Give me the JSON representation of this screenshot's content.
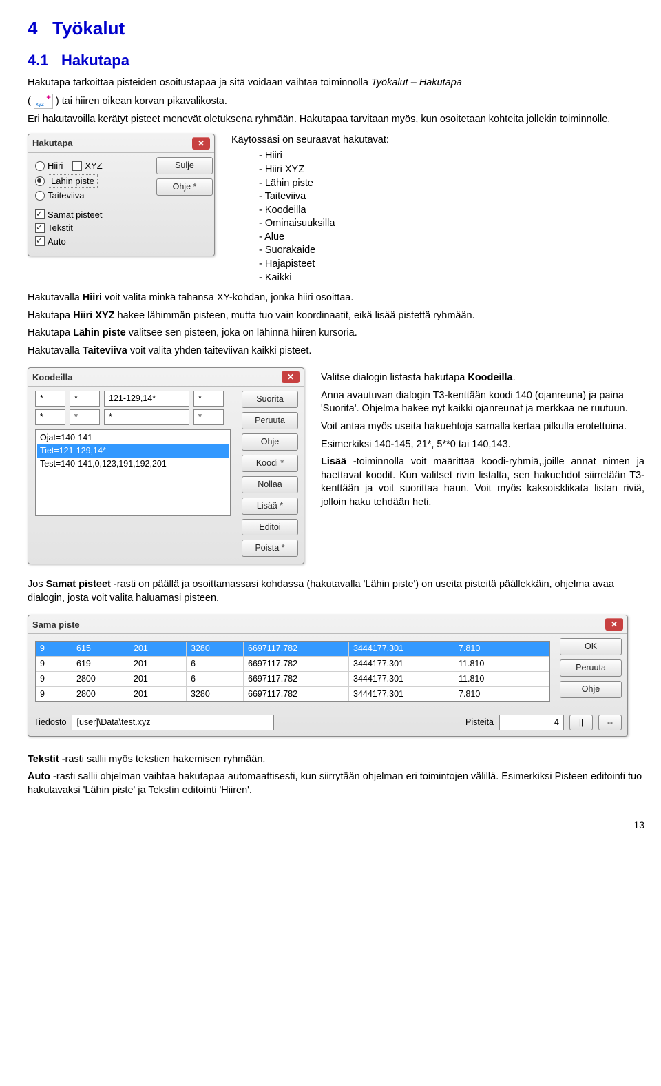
{
  "headings": {
    "h1_num": "4",
    "h1_text": "Työkalut",
    "h2_num": "4.1",
    "h2_text": "Hakutapa"
  },
  "intro": {
    "p1_a": "Hakutapa tarkoittaa pisteiden osoitustapaa ja sitä voidaan vaihtaa toiminnolla ",
    "p1_italic": "Työkalut – Hakutapa",
    "p1_open": "( ",
    "p1_close": " ) tai hiiren oikean korvan pikavalikosta.",
    "p2": "Eri hakutavoilla kerätyt pisteet menevät oletuksena ryhmään. Hakutapaa tarvitaan myös, kun osoitetaan kohteita jollekin toiminnolle."
  },
  "hakutapa_dialog": {
    "title": "Hakutapa",
    "radio1": "Hiiri",
    "radio2": "Lähin piste",
    "radio3": "Taiteviiva",
    "check_xyz": "XYZ",
    "check_samat": "Samat pisteet",
    "check_tekstit": "Tekstit",
    "check_auto": "Auto",
    "btn_sulje": "Sulje",
    "btn_ohje": "Ohje *"
  },
  "list_intro": "Käytössäsi on seuraavat hakutavat:",
  "modes": [
    "Hiiri",
    "Hiiri XYZ",
    "Lähin piste",
    "Taiteviiva",
    "Koodeilla",
    "Ominaisuuksilla",
    "Alue",
    "Suorakaide",
    "Hajapisteet",
    "Kaikki"
  ],
  "mid": {
    "p1a": "Hakutavalla ",
    "p1b": "Hiiri",
    "p1c": " voit valita minkä tahansa XY-kohdan, jonka hiiri osoittaa.",
    "p2a": "Hakutapa ",
    "p2b": "Hiiri XYZ",
    "p2c": " hakee lähimmän pisteen, mutta tuo vain koordinaatit, eikä lisää pistettä ryhmään.",
    "p3a": "Hakutapa ",
    "p3b": "Lähin piste",
    "p3c": " valitsee sen pisteen, joka on lähinnä hiiren kursoria.",
    "p4a": "Hakutavalla ",
    "p4b": "Taiteviiva",
    "p4c": " voit valita yhden taiteviivan kaikki pisteet."
  },
  "koodeilla_dialog": {
    "title": "Koodeilla",
    "btn_suorita": "Suorita",
    "btn_peruuta": "Peruuta",
    "btn_ohje": "Ohje",
    "btn_koodi": "Koodi *",
    "btn_nollaa": "Nollaa",
    "btn_lisaa": "Lisää *",
    "btn_editoi": "Editoi",
    "btn_poista": "Poista *",
    "star": "*",
    "f1": "121-129,14*",
    "row1": "Ojat=140-141",
    "row2": "Tiet=121-129,14*",
    "row3": "Test=140-141,0,123,191,192,201"
  },
  "koodeilla_text": {
    "p1a": "Valitse dialogin listasta hakutapa ",
    "p1b": "Koodeilla",
    "p1c": ".",
    "p2": "Anna avautuvan dialogin T3-kenttään koodi 140 (ojanreuna) ja paina 'Suorita'. Ohjelma hakee nyt kaikki ojanreunat ja merkkaa ne ruutuun.",
    "p3": "Voit antaa myös useita hakuehtoja samalla kertaa pilkulla erotettuina.",
    "p4": "Esimerkiksi 140-145, 21*, 5**0 tai 140,143.",
    "p5a": "Lisää",
    "p5b": " -toiminnolla voit määrittää koodi-ryhmiä,,joille annat nimen ja haettavat koodit. Kun valitset rivin listalta, sen hakuehdot siirretään T3-kenttään ja voit suorittaa haun. Voit myös kaksoisklikata listan riviä, jolloin haku tehdään heti."
  },
  "samat_intro": "Jos Samat pisteet -rasti on päällä ja osoittamassasi kohdassa (hakutavalla 'Lähin piste') on useita pisteitä päällekkäin, ohjelma avaa dialogin, josta voit valita haluamasi pisteen.",
  "samat_intro_bold": "Samat pisteet",
  "sama_dialog": {
    "title": "Sama piste",
    "btn_ok": "OK",
    "btn_peruuta": "Peruuta",
    "btn_ohje": "Ohje",
    "rows": [
      [
        "9",
        "615",
        "201",
        "3280",
        "6697117.782",
        "3444177.301",
        "7.810"
      ],
      [
        "9",
        "619",
        "201",
        "6",
        "6697117.782",
        "3444177.301",
        "11.810"
      ],
      [
        "9",
        "2800",
        "201",
        "6",
        "6697117.782",
        "3444177.301",
        "11.810"
      ],
      [
        "9",
        "2800",
        "201",
        "3280",
        "6697117.782",
        "3444177.301",
        "7.810"
      ]
    ],
    "label_tiedosto": "Tiedosto",
    "tiedosto_value": "[user]\\Data\\test.xyz",
    "label_pisteita": "Pisteitä",
    "pisteita_value": "4",
    "btn_bar": "||",
    "btn_minus": "--"
  },
  "footer": {
    "p1a": "Tekstit",
    "p1b": " -rasti sallii myös tekstien hakemisen ryhmään.",
    "p2a": "Auto",
    "p2b": " -rasti sallii ohjelman vaihtaa hakutapaa automaattisesti, kun siirrytään ohjelman eri toimintojen välillä. Esimerkiksi Pisteen editointi tuo hakutavaksi 'Lähin piste' ja Tekstin editointi 'Hiiren'."
  },
  "pagenum": "13"
}
